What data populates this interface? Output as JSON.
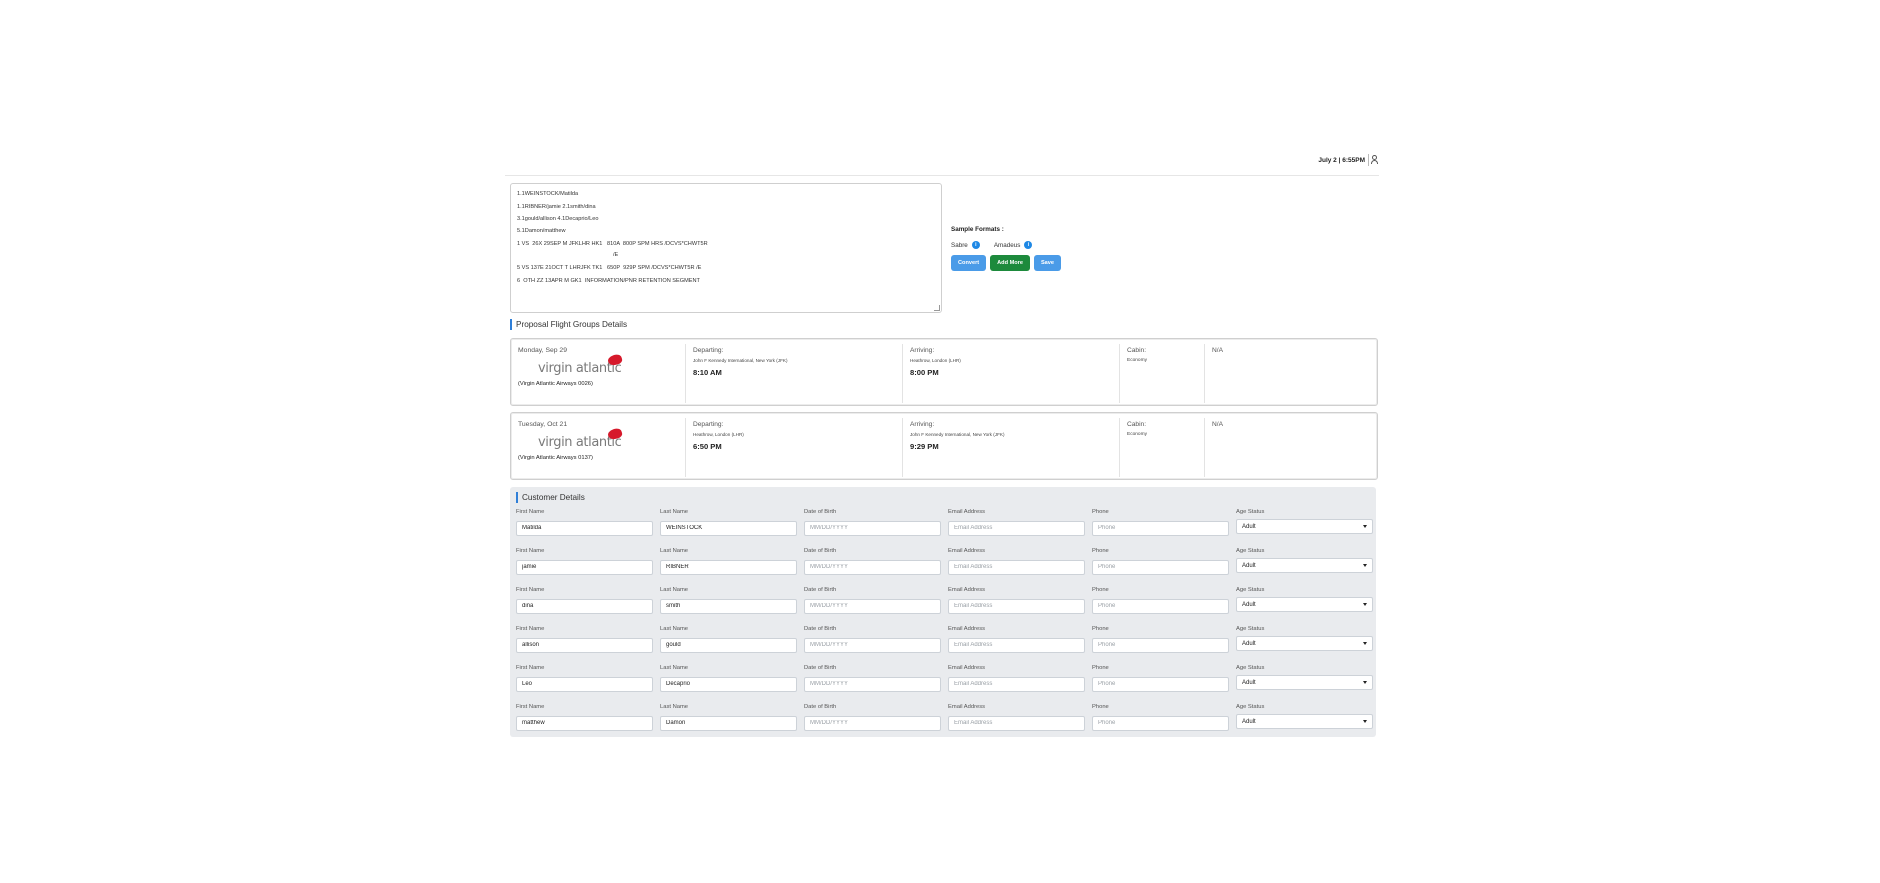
{
  "header": {
    "datetime": "July 2 | 6:55PM",
    "user_icon": "user-icon"
  },
  "pnr": {
    "lines": [
      "1.1WEINSTOCK/Matilda",
      "1.1RIBNER/jamie 2.1smith/dina",
      "3.1gould/allison 4.1Decaprio/Leo",
      "5.1Damon/matthew",
      "1 VS  26X 29SEP M JFKLHR HK1   810A  800P SPM HRS /DCVS*CHWT5R",
      "/E",
      "5 VS 137E 21OCT T LHRJFK TK1   650P  929P SPM /DCVS*CHWT5R /E",
      "6  OTH ZZ 13APR M GK1  INFORMATION/PNR RETENTION SEGMENT"
    ]
  },
  "samples": {
    "title": "Sample Formats :",
    "formats": [
      "Sabre",
      "Amadeus"
    ],
    "info_icon": "i"
  },
  "actions": {
    "convert": "Convert",
    "add_more": "Add More",
    "save": "Save"
  },
  "flights_section": {
    "title": "Proposal Flight Groups Details",
    "flights": [
      {
        "date": "Monday, Sep 29",
        "logo_text": "virgin atlantic",
        "airline": "(Virgin Atlantic Airways 0026)",
        "departing_label": "Departing:",
        "departing_airport": "John F Kennedy International, New York (JFK)",
        "departing_time": "8:10 AM",
        "arriving_label": "Arriving:",
        "arriving_airport": "Heathrow, London (LHR)",
        "arriving_time": "8:00 PM",
        "cabin_label": "Cabin:",
        "cabin": "Economy",
        "extra": "N/A"
      },
      {
        "date": "Tuesday, Oct 21",
        "logo_text": "virgin atlantic",
        "airline": "(Virgin Atlantic Airways 0137)",
        "departing_label": "Departing:",
        "departing_airport": "Heathrow, London (LHR)",
        "departing_time": "6:50 PM",
        "arriving_label": "Arriving:",
        "arriving_airport": "John F Kennedy International, New York (JFK)",
        "arriving_time": "9:29 PM",
        "cabin_label": "Cabin:",
        "cabin": "Economy",
        "extra": "N/A"
      }
    ]
  },
  "customers": {
    "title": "Customer Details",
    "labels": {
      "first_name": "First Name",
      "last_name": "Last Name",
      "dob": "Date of Birth",
      "email": "Email Address",
      "phone": "Phone",
      "age_status": "Age Status"
    },
    "placeholders": {
      "dob": "MM/DD/YYYY",
      "email": "Email Address",
      "phone": "Phone"
    },
    "rows": [
      {
        "first_name": "Matilda",
        "last_name": "WEINSTOCK",
        "age_status": "Adult"
      },
      {
        "first_name": "jamie",
        "last_name": "RIBNER",
        "age_status": "Adult"
      },
      {
        "first_name": "dina",
        "last_name": "smith",
        "age_status": "Adult"
      },
      {
        "first_name": "allison",
        "last_name": "gould",
        "age_status": "Adult"
      },
      {
        "first_name": "Leo",
        "last_name": "Decaprio",
        "age_status": "Adult"
      },
      {
        "first_name": "matthew",
        "last_name": "Damon",
        "age_status": "Adult"
      }
    ]
  }
}
